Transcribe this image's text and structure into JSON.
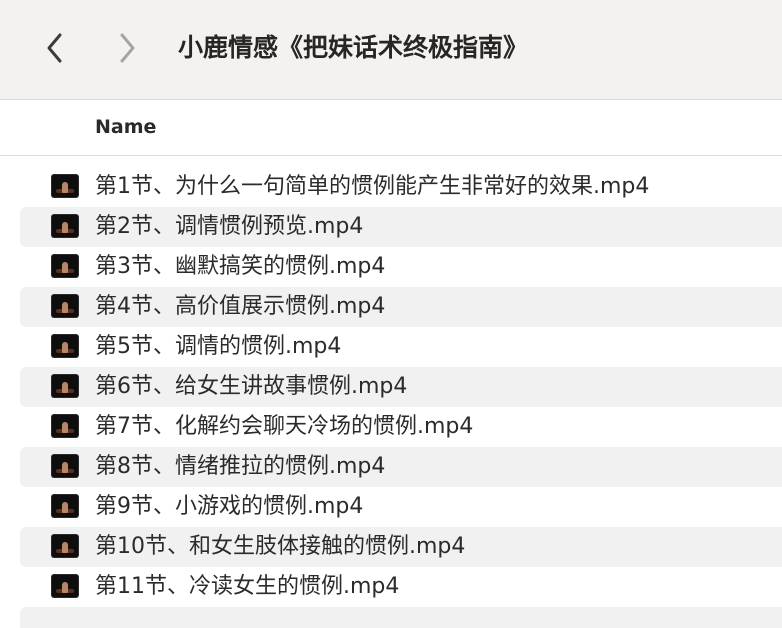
{
  "toolbar": {
    "title": "小鹿情感《把妹话术终极指南》",
    "back_icon": "chevron-left-icon",
    "forward_icon": "chevron-right-icon"
  },
  "columns": {
    "name": "Name"
  },
  "files": [
    {
      "name": "第1节、为什么一句简单的惯例能产生非常好的效果.mp4",
      "icon": "video-thumbnail-icon"
    },
    {
      "name": "第2节、调情惯例预览.mp4",
      "icon": "video-thumbnail-icon"
    },
    {
      "name": "第3节、幽默搞笑的惯例.mp4",
      "icon": "video-thumbnail-icon"
    },
    {
      "name": "第4节、高价值展示惯例.mp4",
      "icon": "video-thumbnail-icon"
    },
    {
      "name": "第5节、调情的惯例.mp4",
      "icon": "video-thumbnail-icon"
    },
    {
      "name": "第6节、给女生讲故事惯例.mp4",
      "icon": "video-thumbnail-icon"
    },
    {
      "name": "第7节、化解约会聊天冷场的惯例.mp4",
      "icon": "video-thumbnail-icon"
    },
    {
      "name": "第8节、情绪推拉的惯例.mp4",
      "icon": "video-thumbnail-icon"
    },
    {
      "name": "第9节、小游戏的惯例.mp4",
      "icon": "video-thumbnail-icon"
    },
    {
      "name": "第10节、和女生肢体接触的惯例.mp4",
      "icon": "video-thumbnail-icon"
    },
    {
      "name": "第11节、冷读女生的惯例.mp4",
      "icon": "video-thumbnail-icon"
    }
  ],
  "colors": {
    "toolbar_bg": "#f4f1ef",
    "stripe": "#f1f1f1",
    "text": "#2b2b2b"
  }
}
